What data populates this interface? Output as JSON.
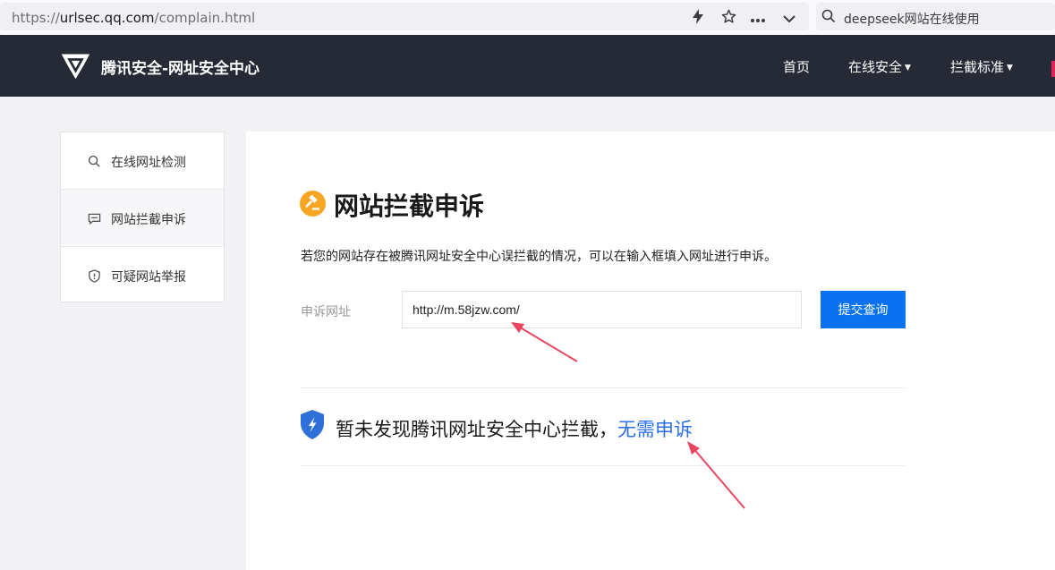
{
  "browser": {
    "url_prefix": "https://",
    "url_host": "urlsec.qq.com",
    "url_path": "/complain.html",
    "search_query": "deepseek网站在线使用",
    "icons": [
      "lightning-icon",
      "star-icon",
      "more-icon",
      "chevron-down-icon",
      "search-icon"
    ]
  },
  "header": {
    "site_title": "腾讯安全-网址安全中心",
    "nav": [
      {
        "label": "首页",
        "has_menu": false
      },
      {
        "label": "在线安全",
        "has_menu": true
      },
      {
        "label": "拦截标准",
        "has_menu": true
      }
    ]
  },
  "sidebar": {
    "items": [
      {
        "label": "在线网址检测",
        "icon": "search-icon"
      },
      {
        "label": "网站拦截申诉",
        "icon": "chat-icon",
        "active": true
      },
      {
        "label": "可疑网站举报",
        "icon": "shield-icon"
      }
    ]
  },
  "main": {
    "title": "网站拦截申诉",
    "description": "若您的网站存在被腾讯网址安全中心误拦截的情况，可以在输入框填入网址进行申诉。",
    "field_label": "申诉网址",
    "url_value": "http://m.58jzw.com/",
    "submit_label": "提交查询",
    "result_text": "暂未发现腾讯网址安全中心拦截，",
    "result_link": "无需申诉"
  },
  "colors": {
    "header_bg": "#262a36",
    "primary": "#0a71f0",
    "link": "#2b6ee8",
    "title_icon": "#f6a623",
    "result_shield": "#2f6fd8",
    "annotation": "#e8475f"
  }
}
